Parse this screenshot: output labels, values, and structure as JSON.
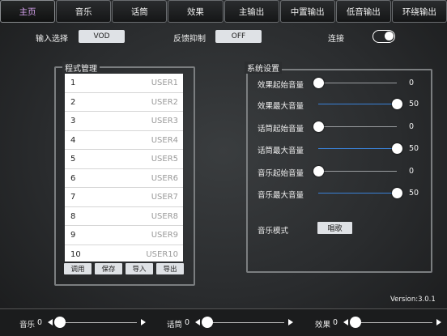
{
  "tabs": [
    "主页",
    "音乐",
    "话筒",
    "效果",
    "主输出",
    "中置输出",
    "低音输出",
    "环绕输出"
  ],
  "active_tab": 0,
  "top": {
    "input_label": "输入选择",
    "input_value": "VOD",
    "feedback_label": "反馈抑制",
    "feedback_value": "OFF",
    "connect_label": "连接",
    "connect_on": true
  },
  "program": {
    "title": "程式管理",
    "items": [
      {
        "num": "1",
        "name": "USER1"
      },
      {
        "num": "2",
        "name": "USER2"
      },
      {
        "num": "3",
        "name": "USER3"
      },
      {
        "num": "4",
        "name": "USER4"
      },
      {
        "num": "5",
        "name": "USER5"
      },
      {
        "num": "6",
        "name": "USER6"
      },
      {
        "num": "7",
        "name": "USER7"
      },
      {
        "num": "8",
        "name": "USER8"
      },
      {
        "num": "9",
        "name": "USER9"
      },
      {
        "num": "10",
        "name": "USER10"
      }
    ],
    "buttons": [
      "调用",
      "保存",
      "导入",
      "导出"
    ]
  },
  "system": {
    "title": "系统设置",
    "sliders": [
      {
        "label": "效果起始音量",
        "value": "0",
        "level": 0.0
      },
      {
        "label": "效果最大音量",
        "value": "50",
        "level": 1.0
      },
      {
        "label": "话筒起始音量",
        "value": "0",
        "level": 0.0
      },
      {
        "label": "话筒最大音量",
        "value": "50",
        "level": 1.0
      },
      {
        "label": "音乐起始音量",
        "value": "0",
        "level": 0.0
      },
      {
        "label": "音乐最大音量",
        "value": "50",
        "level": 1.0
      }
    ],
    "mode_label": "音乐模式",
    "mode_value": "唱歌"
  },
  "version": "Version:3.0.1",
  "bottom": [
    {
      "label": "音乐",
      "value": "0",
      "level": 0.0
    },
    {
      "label": "话筒",
      "value": "0",
      "level": 0.0
    },
    {
      "label": "效果",
      "value": "0",
      "level": 0.0
    }
  ]
}
